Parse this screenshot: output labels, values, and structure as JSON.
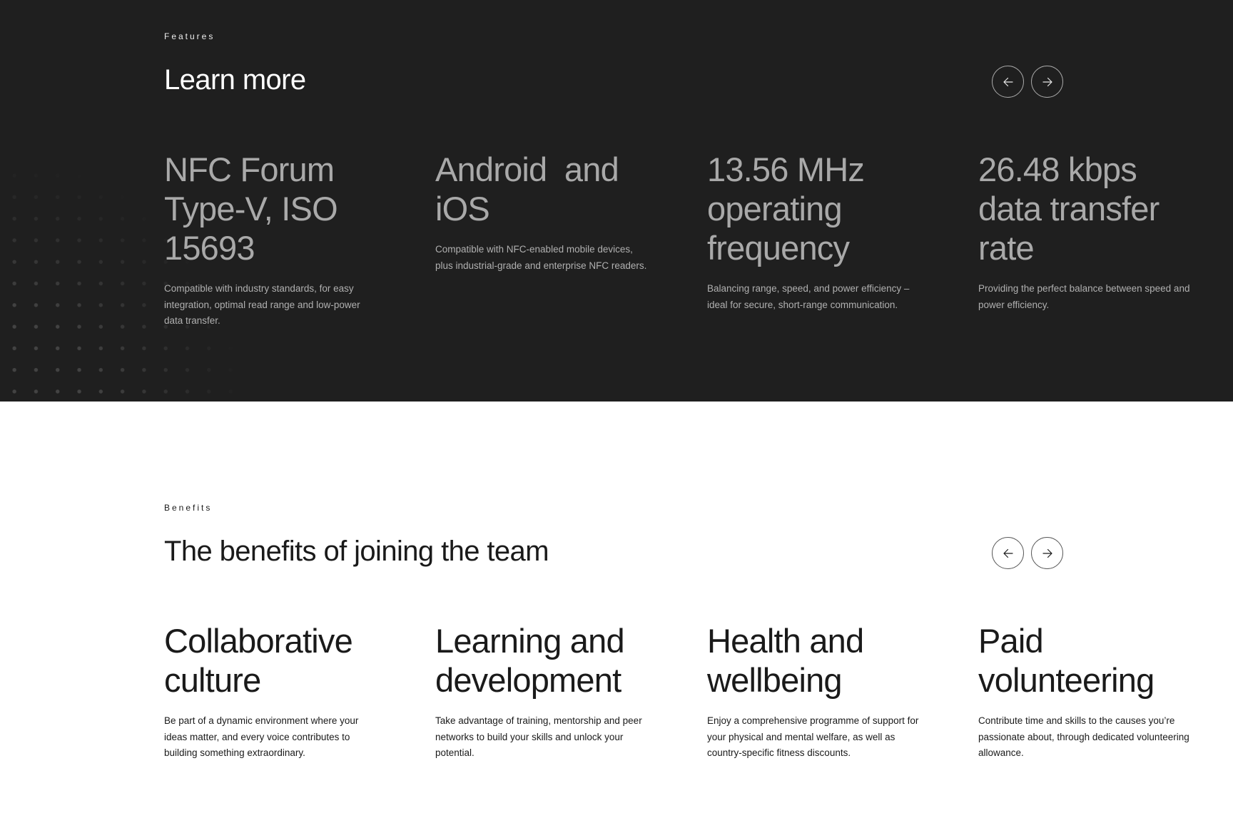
{
  "features": {
    "eyebrow": "Features",
    "title": "Learn more",
    "prev_icon": "arrow-left-icon",
    "next_icon": "arrow-right-icon",
    "cards": [
      {
        "title": "NFC Forum Type-V, ISO 15693",
        "description": "Compatible with industry standards, for easy integration, optimal read range and low-power data transfer."
      },
      {
        "title": "Android  and iOS",
        "description": "Compatible with NFC-enabled mobile devices, plus industrial-grade and enterprise NFC readers."
      },
      {
        "title": "13.56 MHz operating frequency",
        "description": "Balancing range, speed, and power efficiency – ideal for secure, short-range communication."
      },
      {
        "title": "26.48 kbps data transfer rate",
        "description": "Providing the perfect balance between speed and power efficiency."
      }
    ]
  },
  "benefits": {
    "eyebrow": "Benefits",
    "title": "The benefits of joining the team",
    "prev_icon": "arrow-left-icon",
    "next_icon": "arrow-right-icon",
    "cards": [
      {
        "title": "Collaborative culture",
        "description": "Be part of a dynamic environment where your ideas matter, and every voice contributes to building something extraordinary."
      },
      {
        "title": "Learning and development",
        "description": "Take advantage of training, mentorship and peer networks to build your skills and unlock your potential."
      },
      {
        "title": "Health and wellbeing",
        "description": "Enjoy a comprehensive programme of support for your physical and mental welfare, as well as country-specific fitness discounts."
      },
      {
        "title": "Paid volunteering",
        "description": "Contribute time and skills to the causes you’re passionate about, through dedicated volunteering allowance."
      }
    ]
  },
  "colors": {
    "dark_background": "#1f1f1f",
    "light_background": "#ffffff",
    "dark_text": "#1a1a1a",
    "muted_title": "#a9a9a9"
  }
}
